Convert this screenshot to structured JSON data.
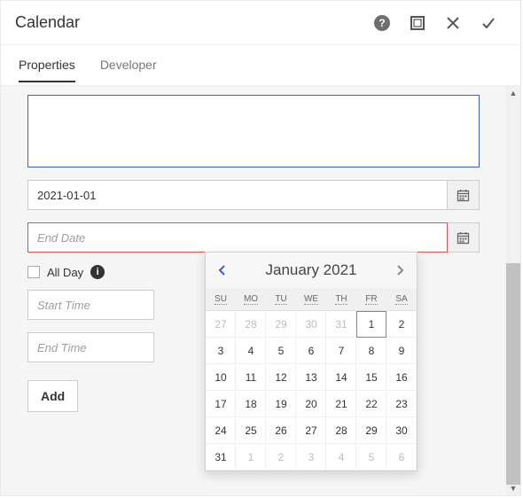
{
  "header": {
    "title": "Calendar"
  },
  "tabs": {
    "properties": "Properties",
    "developer": "Developer"
  },
  "form": {
    "start_date_value": "2021-01-01",
    "end_date_placeholder": "End Date",
    "all_day_label": "All Day",
    "start_time_placeholder": "Start Time",
    "end_time_placeholder": "End Time",
    "add_label": "Add"
  },
  "datepicker": {
    "title": "January 2021",
    "dow": [
      "SU",
      "MO",
      "TU",
      "WE",
      "TH",
      "FR",
      "SA"
    ],
    "cells": [
      {
        "d": "27",
        "o": true
      },
      {
        "d": "28",
        "o": true
      },
      {
        "d": "29",
        "o": true
      },
      {
        "d": "30",
        "o": true
      },
      {
        "d": "31",
        "o": true
      },
      {
        "d": "1",
        "sel": true
      },
      {
        "d": "2"
      },
      {
        "d": "3"
      },
      {
        "d": "4"
      },
      {
        "d": "5"
      },
      {
        "d": "6"
      },
      {
        "d": "7"
      },
      {
        "d": "8"
      },
      {
        "d": "9"
      },
      {
        "d": "10"
      },
      {
        "d": "11"
      },
      {
        "d": "12"
      },
      {
        "d": "13"
      },
      {
        "d": "14"
      },
      {
        "d": "15"
      },
      {
        "d": "16"
      },
      {
        "d": "17"
      },
      {
        "d": "18"
      },
      {
        "d": "19"
      },
      {
        "d": "20"
      },
      {
        "d": "21"
      },
      {
        "d": "22"
      },
      {
        "d": "23"
      },
      {
        "d": "24"
      },
      {
        "d": "25"
      },
      {
        "d": "26"
      },
      {
        "d": "27"
      },
      {
        "d": "28"
      },
      {
        "d": "29"
      },
      {
        "d": "30"
      },
      {
        "d": "31"
      },
      {
        "d": "1",
        "o": true
      },
      {
        "d": "2",
        "o": true
      },
      {
        "d": "3",
        "o": true
      },
      {
        "d": "4",
        "o": true
      },
      {
        "d": "5",
        "o": true
      },
      {
        "d": "6",
        "o": true
      }
    ]
  }
}
